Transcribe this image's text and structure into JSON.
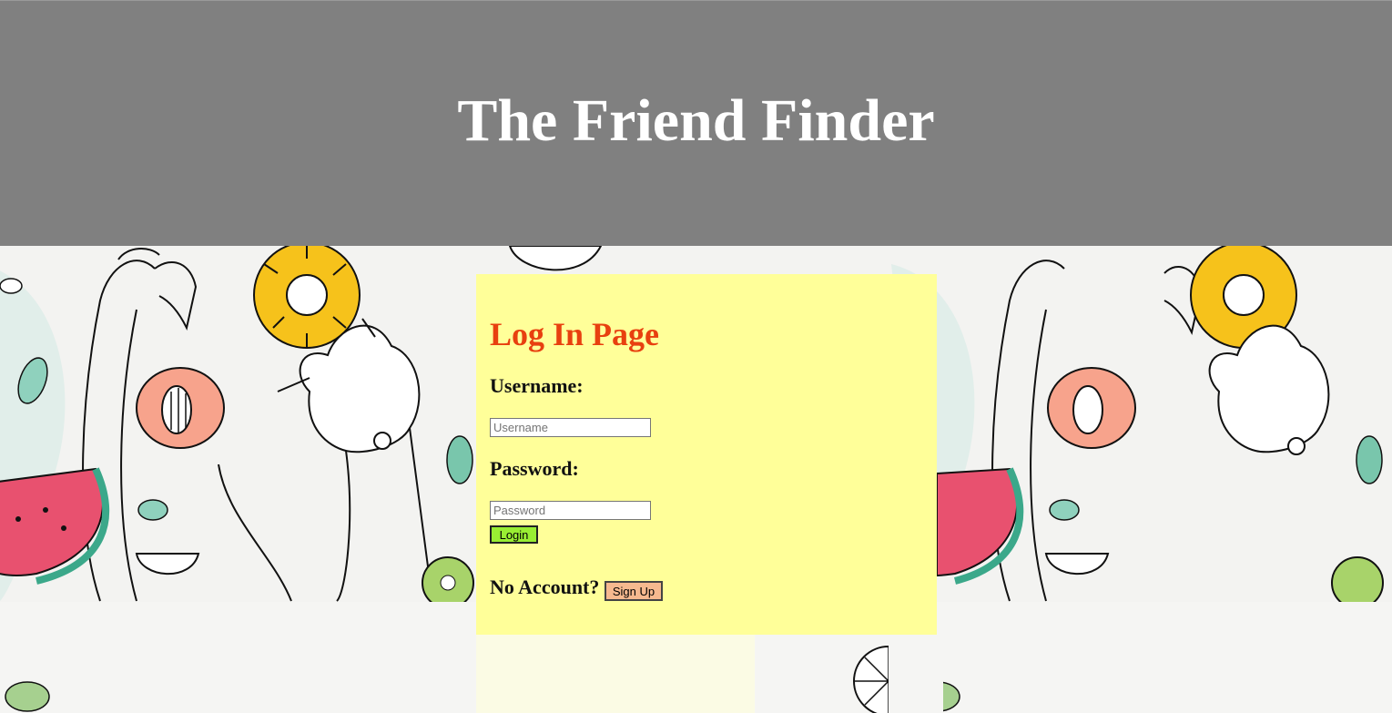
{
  "header": {
    "title": "The Friend Finder"
  },
  "login": {
    "title": "Log In Page",
    "username_label": "Username:",
    "username_placeholder": "Username",
    "password_label": "Password:",
    "password_placeholder": "Password",
    "login_button": "Login",
    "no_account_text": "No Account?",
    "signup_button": "Sign Up"
  },
  "colors": {
    "header_bg": "#808080",
    "card_bg": "#ffff99",
    "title_color": "#e8400f",
    "login_button_bg": "#99ee33",
    "signup_button_bg": "#f6b98f"
  },
  "background_illustrations": [
    "flamingo-icon",
    "pineapple-ring-icon",
    "fox-icon",
    "watermelon-icon",
    "peach-icon",
    "kiwi-icon",
    "leaf-icon",
    "lemon-slice-icon"
  ]
}
